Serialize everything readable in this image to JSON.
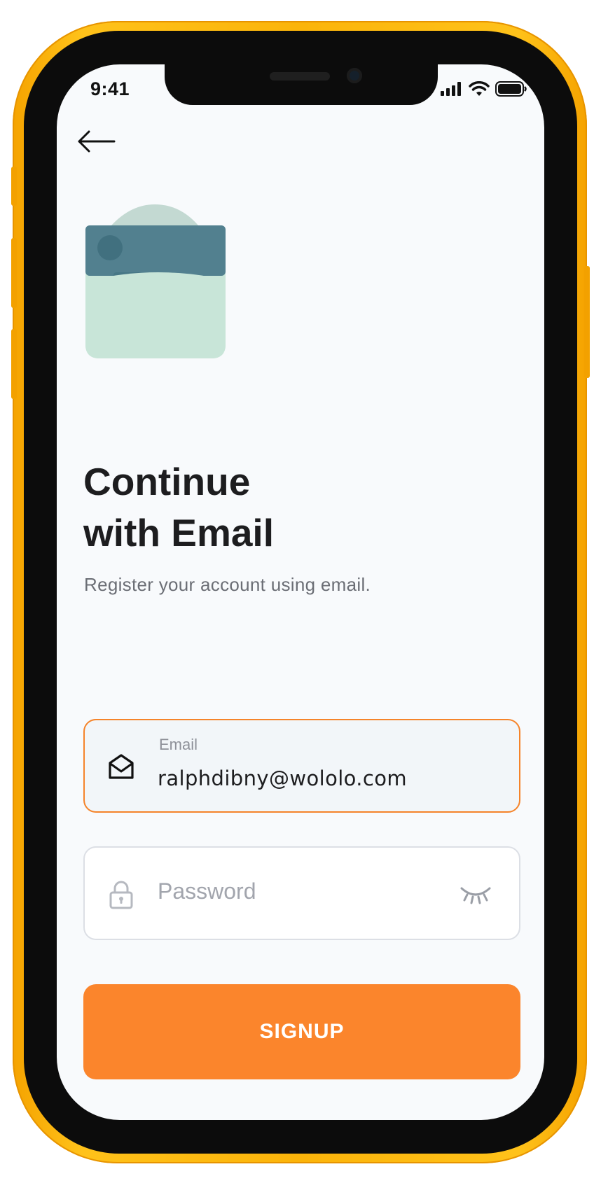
{
  "status_bar": {
    "time": "9:41",
    "icons": [
      "signal-icon",
      "wifi-icon",
      "battery-icon"
    ]
  },
  "nav": {
    "back_icon": "back-arrow-icon"
  },
  "header": {
    "title_line1": "Continue",
    "title_line2": "with Email",
    "subtitle": "Register your account using email."
  },
  "form": {
    "email": {
      "label": "Email",
      "value": "ralphdibny@wololo.com",
      "icon": "envelope-icon"
    },
    "password": {
      "placeholder": "Password",
      "icon": "lock-icon",
      "toggle_icon": "eye-closed-icon"
    },
    "submit_label": "SIGNUP"
  },
  "colors": {
    "accent": "#fb852c",
    "device_frame": "#fbb40a",
    "background": "#f8fafc",
    "text_primary": "#1d1d1f",
    "text_secondary": "#6b6e75"
  }
}
